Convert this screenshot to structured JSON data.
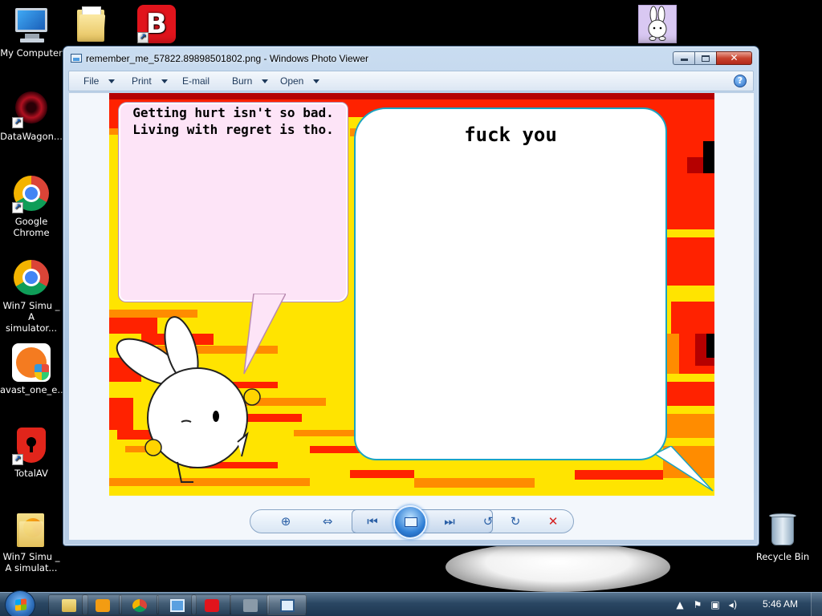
{
  "desktop": {
    "icons": [
      {
        "label": "My Computer",
        "icon": "computer-icon"
      },
      {
        "label": "",
        "icon": "folder-icon"
      },
      {
        "label": "",
        "icon": "bitdefender-icon",
        "glyph": "B"
      },
      {
        "label": "",
        "icon": "bunny-icon"
      },
      {
        "label": "DataWagon...",
        "icon": "datawagon-icon"
      },
      {
        "label": "Google Chrome",
        "icon": "chrome-icon"
      },
      {
        "label": "Win7 Simu _ A simulator...",
        "icon": "chrome-icon"
      },
      {
        "label": "avast_one_e...",
        "icon": "avast-icon"
      },
      {
        "label": "TotalAV",
        "icon": "totalav-icon"
      },
      {
        "label": "Win7 Simu _ A simulat...",
        "icon": "folder-music-icon"
      },
      {
        "label": "Recycle Bin",
        "icon": "recycle-bin-icon"
      }
    ]
  },
  "window": {
    "title": "remember_me_57822.89898501802.png - Windows Photo Viewer",
    "menu": [
      {
        "label": "File",
        "has_dropdown": true
      },
      {
        "label": "Print",
        "has_dropdown": true
      },
      {
        "label": "E-mail",
        "has_dropdown": false
      },
      {
        "label": "Burn",
        "has_dropdown": true
      },
      {
        "label": "Open",
        "has_dropdown": true
      }
    ],
    "caption_buttons": {
      "minimize": "minimize-icon",
      "maximize": "maximize-icon",
      "close": "✕"
    },
    "help_glyph": "?"
  },
  "photo": {
    "left_bubble_text": [
      "Getting hurt isn't so bad.",
      "Living with regret is tho."
    ],
    "right_bubble_text": "fuck you",
    "colors": {
      "background_yellow": "#ffe400",
      "fire_red": "#ff2200",
      "fire_orange": "#ff8c00",
      "left_bubble": "#fde4f7",
      "right_bubble_border": "#1aa3c2"
    }
  },
  "controls": {
    "zoom": "⊕",
    "actual_size": "⇔",
    "previous": "⏮",
    "slideshow": "slideshow-icon",
    "next": "⏭",
    "rotate_ccw": "↺",
    "rotate_cw": "↻",
    "delete": "✕"
  },
  "taskbar": {
    "clock": "5:46 AM",
    "pinned": [
      "explorer-icon",
      "media-player-icon",
      "chrome-icon",
      "remote-desktop-icon",
      "bitdefender-icon",
      "app-icon",
      "photo-viewer-icon"
    ],
    "tray": [
      "tray-arrow-icon",
      "flag-icon",
      "network-icon",
      "volume-icon"
    ]
  }
}
